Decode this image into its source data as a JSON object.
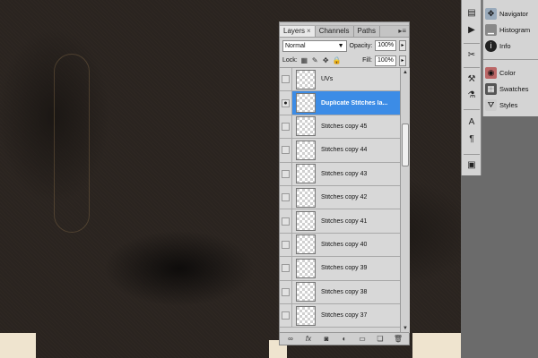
{
  "layers_panel": {
    "tabs": [
      "Layers",
      "Channels",
      "Paths"
    ],
    "close_glyph": "×",
    "menu_glyph": "▸≡",
    "blend_mode": "Normal",
    "opacity_label": "Opacity:",
    "opacity_value": "100%",
    "lock_label": "Lock:",
    "fill_label": "Fill:",
    "fill_value": "100%",
    "layers": [
      {
        "name": "UVs",
        "visible": false,
        "selected": false
      },
      {
        "name": "Duplicate Stitches la...",
        "visible": true,
        "selected": true
      },
      {
        "name": "Stitches copy 45",
        "visible": false,
        "selected": false
      },
      {
        "name": "Stitches copy 44",
        "visible": false,
        "selected": false
      },
      {
        "name": "Stitches copy 43",
        "visible": false,
        "selected": false
      },
      {
        "name": "Stitches copy 42",
        "visible": false,
        "selected": false
      },
      {
        "name": "Stitches copy 41",
        "visible": false,
        "selected": false
      },
      {
        "name": "Stitches copy 40",
        "visible": false,
        "selected": false
      },
      {
        "name": "Stitches copy 39",
        "visible": false,
        "selected": false
      },
      {
        "name": "Stitches copy 38",
        "visible": false,
        "selected": false
      },
      {
        "name": "Stitches copy 37",
        "visible": false,
        "selected": false
      }
    ],
    "footer_icons": [
      "link-icon",
      "fx-icon",
      "mask-icon",
      "adjustment-icon",
      "group-icon",
      "new-layer-icon",
      "trash-icon"
    ]
  },
  "right_panels": {
    "group1": [
      "Navigator",
      "Histogram",
      "Info"
    ],
    "group2": [
      "Color",
      "Swatches",
      "Styles"
    ]
  },
  "colors": {
    "selection": "#3c8ce6",
    "panel": "#d4d4d4",
    "dock": "#6b6b6b"
  }
}
